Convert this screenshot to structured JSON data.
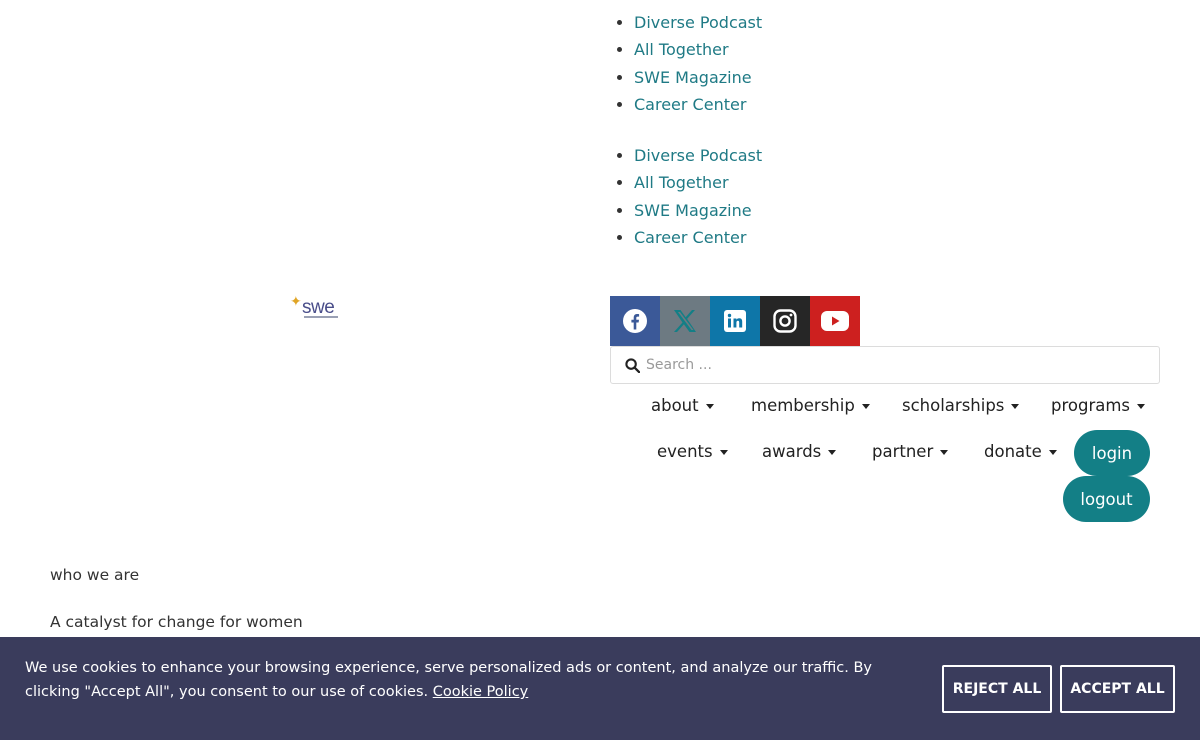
{
  "top_links_a": [
    "Diverse Podcast",
    "All Together",
    "SWE Magazine",
    "Career Center"
  ],
  "top_links_b": [
    "Diverse Podcast",
    "All Together",
    "SWE Magazine",
    "Career Center"
  ],
  "logo": {
    "text": "swe"
  },
  "social": [
    {
      "name": "facebook",
      "color": "#3b5998"
    },
    {
      "name": "x",
      "color": "#6d7a82"
    },
    {
      "name": "linkedin",
      "color": "#0e76a8"
    },
    {
      "name": "instagram",
      "color": "#262626"
    },
    {
      "name": "youtube",
      "color": "#cd201f"
    }
  ],
  "search": {
    "placeholder": "Search ..."
  },
  "nav": {
    "row1": [
      "about",
      "membership",
      "scholarships",
      "programs"
    ],
    "row2": [
      "events",
      "awards",
      "partner",
      "donate"
    ],
    "login": "login",
    "logout": "logout"
  },
  "content": {
    "who": "who we are",
    "catalyst": "A catalyst for change for women"
  },
  "cookie": {
    "message": "We use cookies to enhance your browsing experience, serve personalized ads or content, and analyze our traffic. By clicking \"Accept All\", you consent to our use of cookies.",
    "policy_link": "Cookie Policy",
    "reject": "REJECT ALL",
    "accept": "ACCEPT ALL"
  },
  "colors": {
    "accent": "#137f86",
    "link": "#1f7a85",
    "cookie_bg": "#3a3c5c"
  }
}
